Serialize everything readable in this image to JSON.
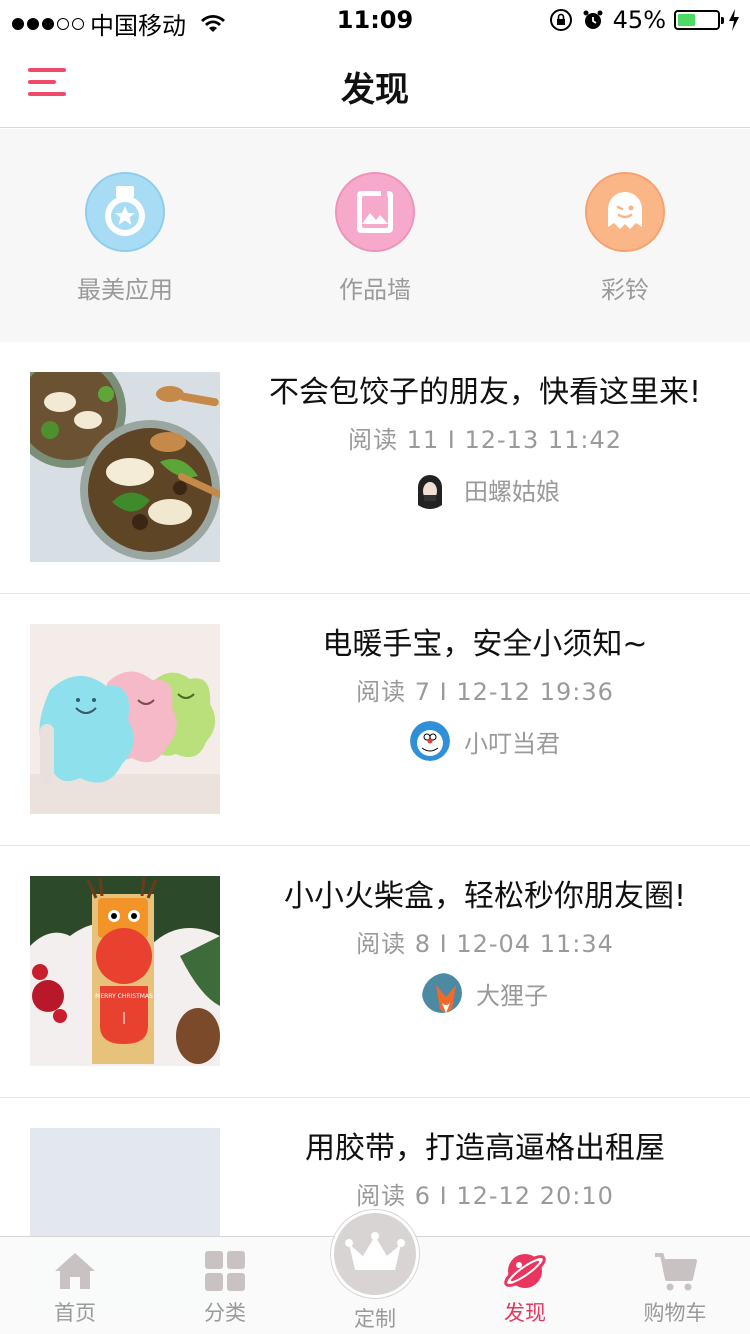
{
  "status_bar": {
    "carrier": "中国移动",
    "time": "11:09",
    "battery_percent": "45%",
    "battery_level": 0.45,
    "signal_bars_filled": 3,
    "signal_bars_total": 5
  },
  "nav": {
    "title": "发现",
    "menu_icon": "hamburger-menu-icon",
    "accent_color": "#f04a6a"
  },
  "quick_links": [
    {
      "label": "最美应用",
      "icon": "medal-icon",
      "color": "#a7dcf4"
    },
    {
      "label": "作品墙",
      "icon": "photo-book-icon",
      "color": "#f6a9cb"
    },
    {
      "label": "彩铃",
      "icon": "ghost-icon",
      "color": "#fbb688"
    }
  ],
  "articles": [
    {
      "title": "不会包饺子的朋友，快看这里来!",
      "meta": "阅读 11 I 12-13 11:42",
      "author": "田螺姑娘"
    },
    {
      "title": "电暖手宝，安全小须知~",
      "meta": "阅读 7 I 12-12 19:36",
      "author": "小叮当君"
    },
    {
      "title": "小小火柴盒，轻松秒你朋友圈!",
      "meta": "阅读 8 I 12-04 11:34",
      "author": "大狸子"
    },
    {
      "title": "用胶带，打造高逼格出租屋",
      "meta": "阅读 6 I 12-12 20:10",
      "author": ""
    }
  ],
  "thumb_text": {
    "merry_christmas": "MERRY CHRISTMAS"
  },
  "tab_bar": {
    "tabs": [
      {
        "label": "首页",
        "icon": "home-icon"
      },
      {
        "label": "分类",
        "icon": "grid-icon"
      },
      {
        "label": "定制",
        "icon": "crown-icon"
      },
      {
        "label": "发现",
        "icon": "planet-icon"
      },
      {
        "label": "购物车",
        "icon": "cart-icon"
      }
    ],
    "active_tab": "发现",
    "active_color": "#e8365e"
  }
}
